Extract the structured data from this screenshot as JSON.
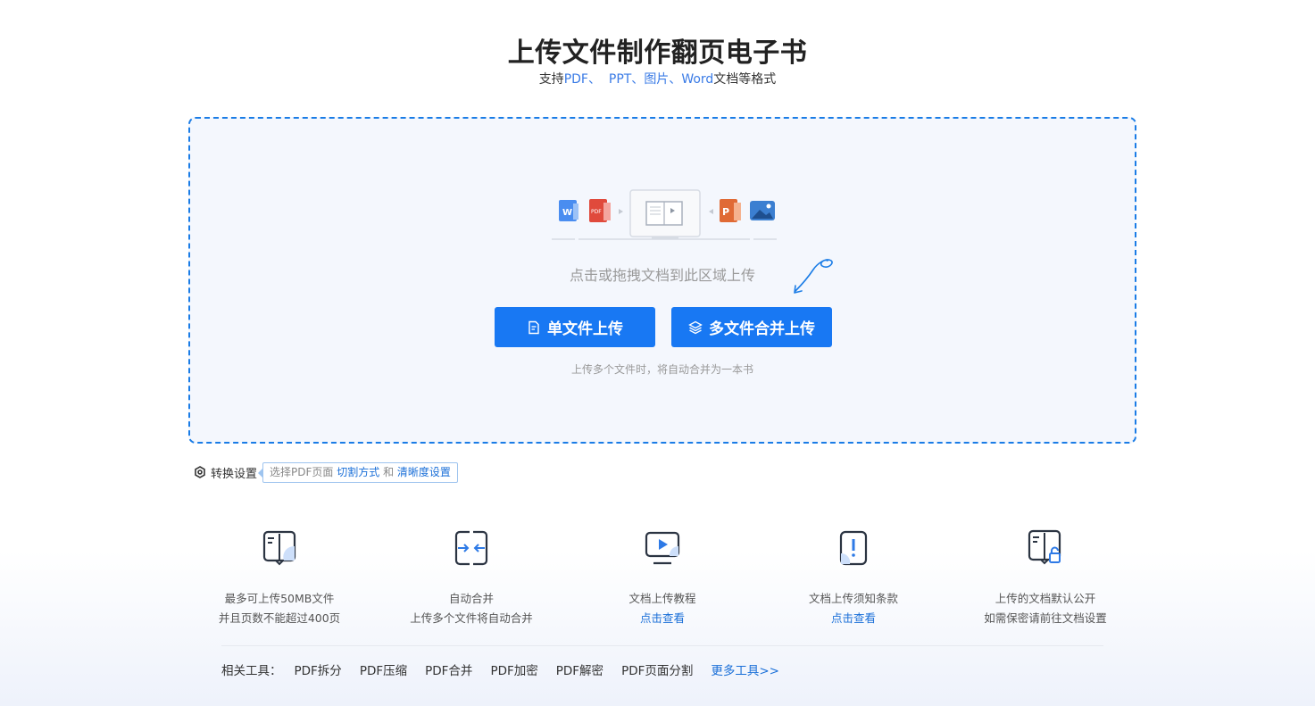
{
  "header": {
    "title": "上传文件制作翻页电子书",
    "subtitle_prefix": "支持",
    "formats": [
      "PDF、",
      "PPT、",
      "图片、",
      "Word"
    ],
    "subtitle_suffix": "文档等格式"
  },
  "upload": {
    "hint": "点击或拖拽文档到此区域上传",
    "single_button": "单文件上传",
    "multi_button": "多文件合并上传",
    "note": "上传多个文件时，将自动合并为一本书",
    "colors": {
      "accent": "#1878f3",
      "dash": "#1a7ce6",
      "zone_bg": "#f4f7fd"
    },
    "illustration_icons": [
      "word-file-icon",
      "pdf-file-icon",
      "book-laptop-icon",
      "ppt-file-icon",
      "image-file-icon"
    ]
  },
  "settings": {
    "label": "转换设置",
    "tag_prefix": "选择PDF页面",
    "tag_link1": "切割方式",
    "tag_mid": "和",
    "tag_link2": "清晰度设置"
  },
  "features": [
    {
      "icon": "book-icon",
      "line1": "最多可上传50MB文件",
      "line2": "并且页数不能超过400页"
    },
    {
      "icon": "merge-icon",
      "line1": "自动合并",
      "line2": "上传多个文件将自动合并"
    },
    {
      "icon": "video-tutorial-icon",
      "line1": "文档上传教程",
      "line2": "点击查看"
    },
    {
      "icon": "notice-icon",
      "line1": "文档上传须知条款",
      "line2": "点击查看"
    },
    {
      "icon": "public-doc-icon",
      "line1": "上传的文档默认公开",
      "line2": "如需保密请前往文档设置"
    }
  ],
  "tools": {
    "label": "相关工具：",
    "items": [
      "PDF拆分",
      "PDF压缩",
      "PDF合并",
      "PDF加密",
      "PDF解密",
      "PDF页面分割"
    ],
    "more": "更多工具>>"
  }
}
